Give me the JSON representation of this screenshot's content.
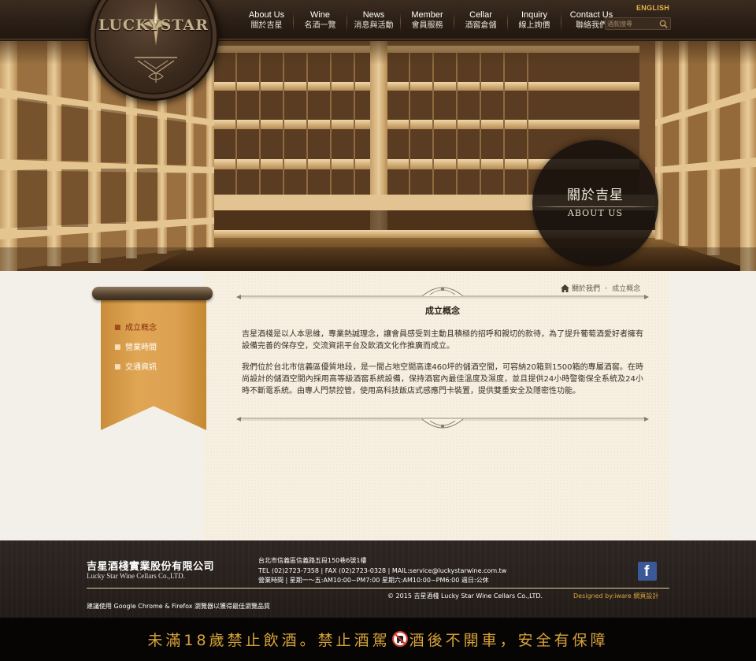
{
  "header": {
    "logo_text": "LUCKYSTAR",
    "english_label": "ENGLISH",
    "search_placeholder": "酒款搜尋",
    "nav": [
      {
        "en": "About Us",
        "zh": "關於吉星"
      },
      {
        "en": "Wine",
        "zh": "名酒一覽"
      },
      {
        "en": "News",
        "zh": "消息與活動"
      },
      {
        "en": "Member",
        "zh": "會員服務"
      },
      {
        "en": "Cellar",
        "zh": "酒窖倉儲"
      },
      {
        "en": "Inquiry",
        "zh": "線上詢價"
      },
      {
        "en": "Contact Us",
        "zh": "聯絡我們"
      }
    ]
  },
  "hero": {
    "title_zh": "關於吉星",
    "title_en": "ABOUT US"
  },
  "sidebar": {
    "items": [
      {
        "label": "成立概念",
        "active": true
      },
      {
        "label": "營業時間",
        "active": false
      },
      {
        "label": "交通資訊",
        "active": false
      }
    ]
  },
  "breadcrumb": {
    "parent": "關於我們",
    "current": "成立概念"
  },
  "main": {
    "title": "成立概念",
    "paragraphs": [
      "吉星酒棧是以人本思維，專業熱誠理念，讓會員感受到主動且積極的招呼和親切的款待，為了提升葡萄酒愛好者擁有設備完善的保存空，交流資訊平台及飲酒文化作推廣而成立。",
      "我們位於台北市信義區優質地段，是一間占地空間高達460坪的儲酒空間，可容納20箱到1500箱的專屬酒窖。在時尚設計的儲酒空間內採用高等級酒窖系統設備，保持酒窖內最佳溫度及濕度，並且提供24小時警衛保全系統及24小時不斷電系統。由專人門禁控管，使用高科技飯店式感應門卡裝置，提供雙重安全及隱密性功能。"
    ]
  },
  "footer": {
    "company_zh": "吉星酒棧實業股份有限公司",
    "company_en": "Lucky Star Wine Cellars Co.,LTD.",
    "address": "台北市信義區信義路五段150巷6號1樓",
    "contact": "TEL (02)2723-7358 | FAX (02)2723-0328 | MAIL:service@luckystarwine.com.tw",
    "hours": "營業時間 | 星期一～五:AM10:00~PM7:00   星期六:AM10:00~PM6:00   週日:公休",
    "copyright": "© 2015 吉星酒棧 Lucky Star Wine Cellars Co.,LTD.",
    "designer": "Designed by:iware 網頁設計",
    "browser_note": "建議使用 Google Chrome & Firefox 瀏覽器以獲得最佳瀏覽品質",
    "facebook_letter": "f"
  },
  "warning": {
    "text_before": "未滿18歲禁止飲酒。禁止酒駕",
    "text_after": "酒後不開車，安全有保障"
  },
  "colors": {
    "accent_gold": "#d7a23a",
    "ribbon": "#dca252",
    "active_link": "#8a2c10",
    "facebook": "#3b5998"
  }
}
